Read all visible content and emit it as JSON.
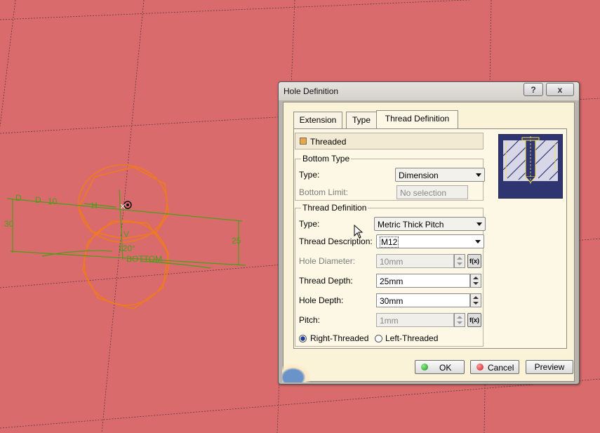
{
  "dialog": {
    "title": "Hole Definition",
    "help_label": "?",
    "close_label": "x",
    "tabs": [
      {
        "label": "Extension"
      },
      {
        "label": "Type"
      },
      {
        "label": "Thread Definition",
        "active": true
      }
    ],
    "threaded": {
      "label": "Threaded",
      "checked": true
    },
    "bottom_type": {
      "title": "Bottom Type",
      "type_label": "Type:",
      "type_value": "Dimension",
      "limit_label": "Bottom Limit:",
      "limit_value": "No selection"
    },
    "thread_definition": {
      "title": "Thread Definition",
      "type_label": "Type:",
      "type_value": "Metric Thick Pitch",
      "desc_label": "Thread Description:",
      "desc_value": "M12",
      "hole_diameter_label": "Hole Diameter:",
      "hole_diameter_value": "10mm",
      "thread_depth_label": "Thread Depth:",
      "thread_depth_value": "25mm",
      "hole_depth_label": "Hole Depth:",
      "hole_depth_value": "30mm",
      "pitch_label": "Pitch:",
      "pitch_value": "1mm",
      "right_label": "Right-Threaded",
      "left_label": "Left-Threaded",
      "right_selected": true
    },
    "formula_icon_label": "f(x)",
    "buttons": {
      "ok": "OK",
      "cancel": "Cancel",
      "preview": "Preview"
    }
  },
  "sketch": {
    "labels": [
      "D",
      "D",
      "10",
      "H",
      "30",
      "25",
      "V",
      "120°",
      "BOTTOM"
    ]
  },
  "colors": {
    "background": "#d96b6c",
    "sketch_orange": "#f07a1e",
    "sketch_green": "#4a9e1a",
    "dialog_panel": "#fdf8e6"
  }
}
